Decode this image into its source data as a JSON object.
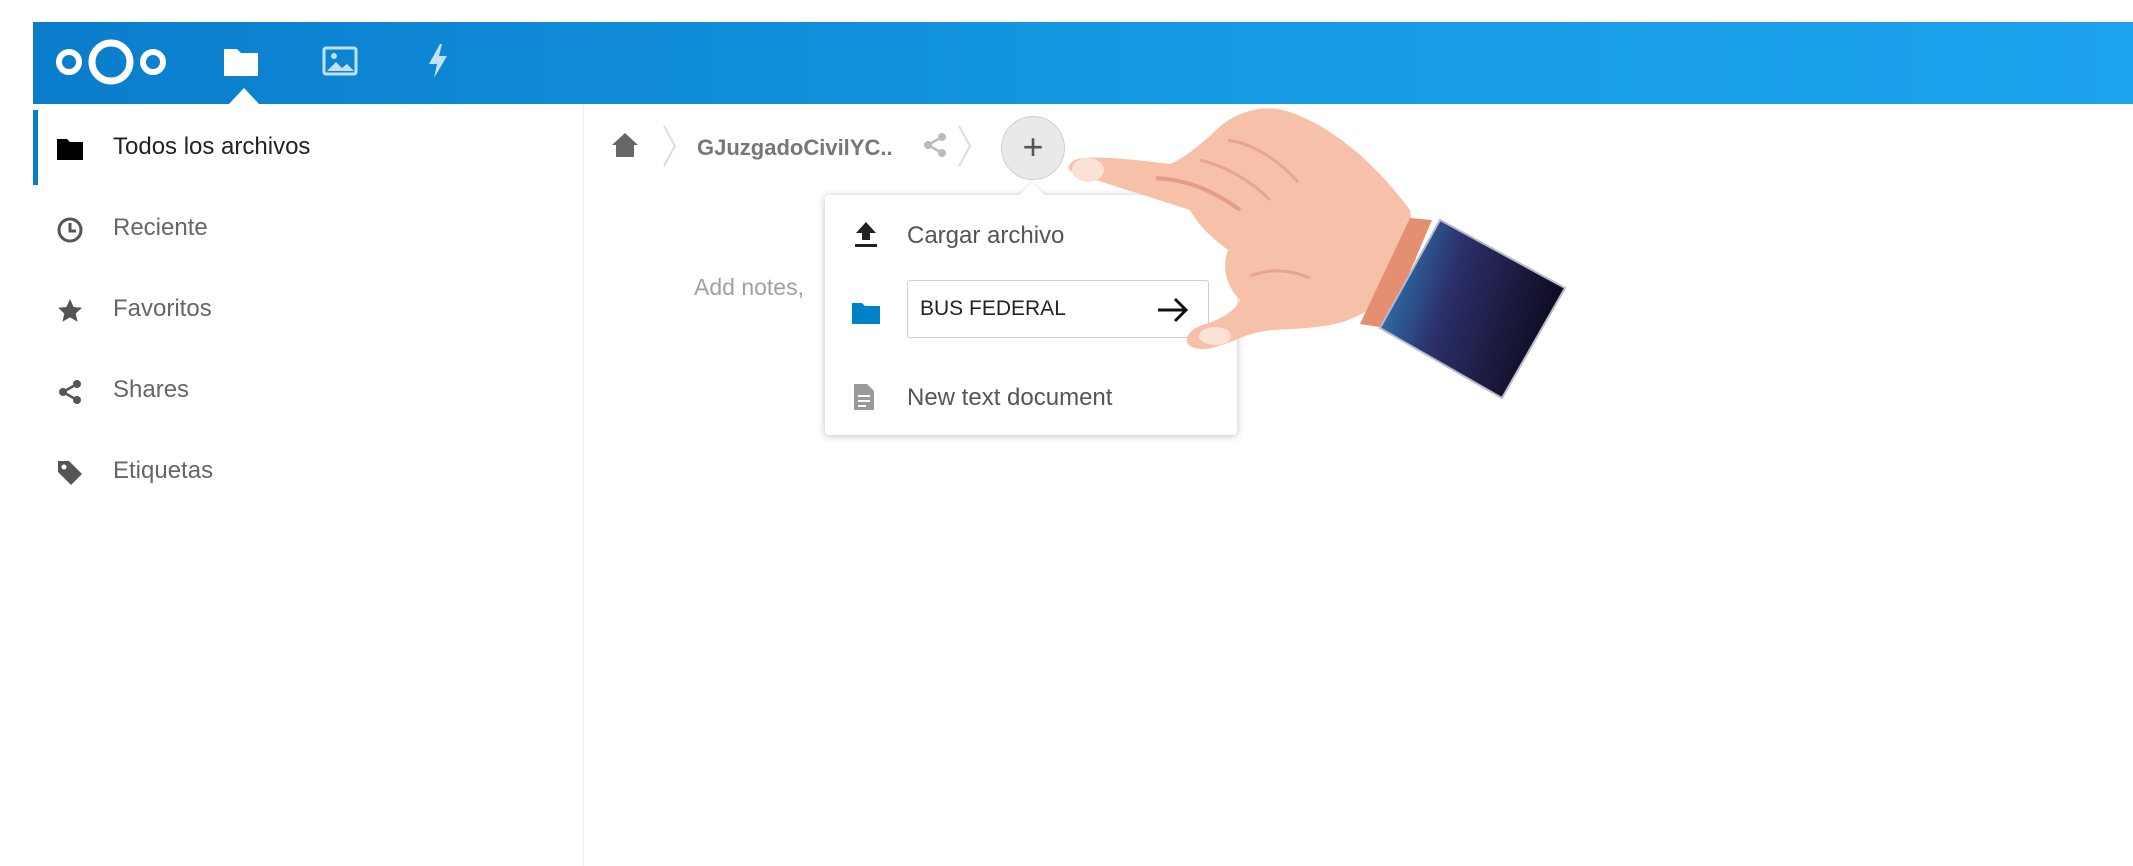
{
  "header": {
    "logo": "nextcloud-logo",
    "apps": [
      {
        "name": "files-app-icon"
      },
      {
        "name": "photos-app-icon"
      },
      {
        "name": "activity-app-icon"
      }
    ],
    "accent": "#0082c9"
  },
  "sidebar": {
    "items": [
      {
        "label": "Todos los archivos",
        "icon": "folder-icon",
        "active": true
      },
      {
        "label": "Reciente",
        "icon": "clock-icon"
      },
      {
        "label": "Favoritos",
        "icon": "star-icon"
      },
      {
        "label": "Shares",
        "icon": "share-icon"
      },
      {
        "label": "Etiquetas",
        "icon": "tag-icon"
      }
    ]
  },
  "breadcrumb": {
    "folder": "GJuzgadoCivilYC..",
    "add_label": "+"
  },
  "content": {
    "notes_placeholder": "Add notes,"
  },
  "new_menu": {
    "upload_label": "Cargar archivo",
    "folder_input_value": "BUS FEDERAL",
    "text_doc_label": "New text document"
  }
}
